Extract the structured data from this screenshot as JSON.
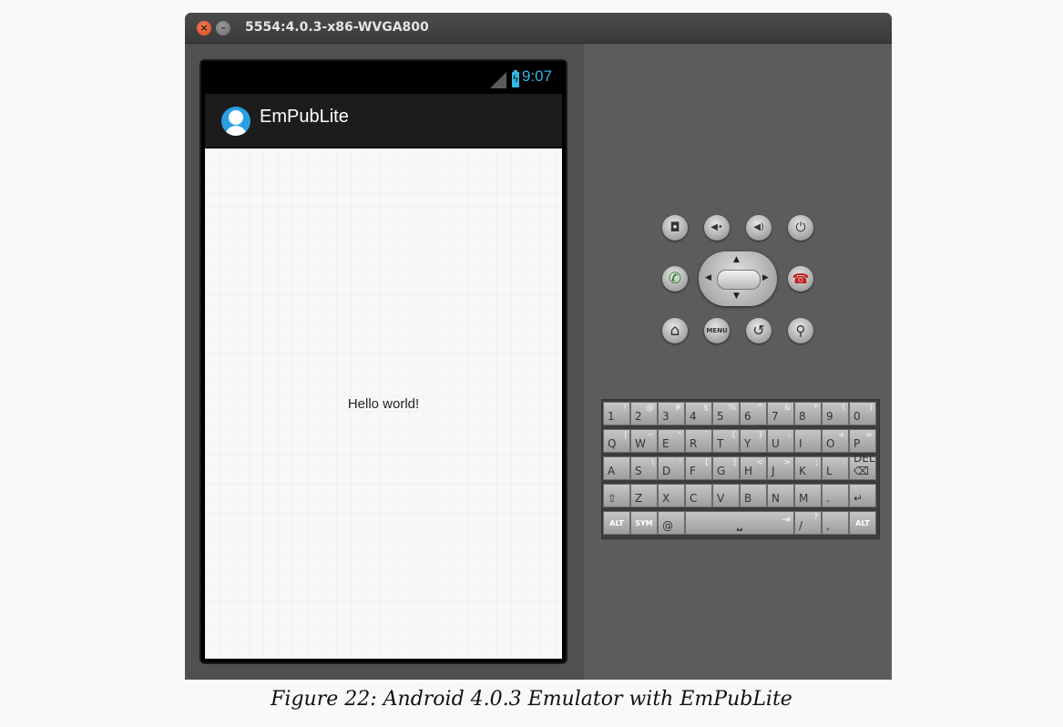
{
  "window": {
    "title": "5554:4.0.3-x86-WVGA800",
    "close_glyph": "×",
    "minimize_glyph": "–"
  },
  "device": {
    "status_bar": {
      "time": "9:07",
      "battery_glyph": "ϟ"
    },
    "action_bar": {
      "app_title": "EmPubLite"
    },
    "content": {
      "text": "Hello world!"
    }
  },
  "controls": {
    "camera": "◘",
    "volume_down": "◀•",
    "volume_up": "◀)",
    "power": "⏻",
    "call": "✆",
    "end_call": "☎",
    "home": "⌂",
    "menu": "MENU",
    "back": "↺",
    "search": "⚲",
    "dpad_up": "▲",
    "dpad_down": "▼",
    "dpad_left": "◀",
    "dpad_right": "▶"
  },
  "keyboard": {
    "rows": [
      [
        {
          "main": "1",
          "shift": "!"
        },
        {
          "main": "2",
          "shift": "@"
        },
        {
          "main": "3",
          "shift": "#"
        },
        {
          "main": "4",
          "shift": "$"
        },
        {
          "main": "5",
          "shift": "%"
        },
        {
          "main": "6",
          "shift": "^"
        },
        {
          "main": "7",
          "shift": "&"
        },
        {
          "main": "8",
          "shift": "*"
        },
        {
          "main": "9",
          "shift": "("
        },
        {
          "main": "0",
          "shift": ")"
        }
      ],
      [
        {
          "main": "Q",
          "shift": "|"
        },
        {
          "main": "W",
          "shift": "~"
        },
        {
          "main": "E",
          "shift": "\""
        },
        {
          "main": "R",
          "shift": "`"
        },
        {
          "main": "T",
          "shift": "{"
        },
        {
          "main": "Y",
          "shift": "}"
        },
        {
          "main": "U",
          "shift": "-"
        },
        {
          "main": "I",
          "shift": ""
        },
        {
          "main": "O",
          "shift": "+"
        },
        {
          "main": "P",
          "shift": "="
        }
      ],
      [
        {
          "main": "A",
          "shift": ""
        },
        {
          "main": "S",
          "shift": "\\"
        },
        {
          "main": "D",
          "shift": "'"
        },
        {
          "main": "F",
          "shift": "["
        },
        {
          "main": "G",
          "shift": "]"
        },
        {
          "main": "H",
          "shift": "<"
        },
        {
          "main": "J",
          "shift": ">"
        },
        {
          "main": "K",
          "shift": ";"
        },
        {
          "main": "L",
          "shift": ":"
        },
        {
          "main": "DEL ⌫",
          "shift": ""
        }
      ],
      [
        {
          "main": "⇧",
          "shift": ""
        },
        {
          "main": "Z",
          "shift": ""
        },
        {
          "main": "X",
          "shift": ""
        },
        {
          "main": "C",
          "shift": ""
        },
        {
          "main": "V",
          "shift": ""
        },
        {
          "main": "B",
          "shift": ""
        },
        {
          "main": "N",
          "shift": ""
        },
        {
          "main": "M",
          "shift": ""
        },
        {
          "main": ".",
          "shift": ""
        },
        {
          "main": "↵",
          "shift": ""
        }
      ]
    ],
    "bottom_row": {
      "alt_left": "ALT",
      "sym": "SYM",
      "at": "@",
      "space": "⎵",
      "tab": "⇥",
      "slash": "/",
      "question": "?",
      "comma": ",",
      "alt_right": "ALT"
    }
  },
  "caption": "Figure 22: Android 4.0.3 Emulator with EmPubLite"
}
